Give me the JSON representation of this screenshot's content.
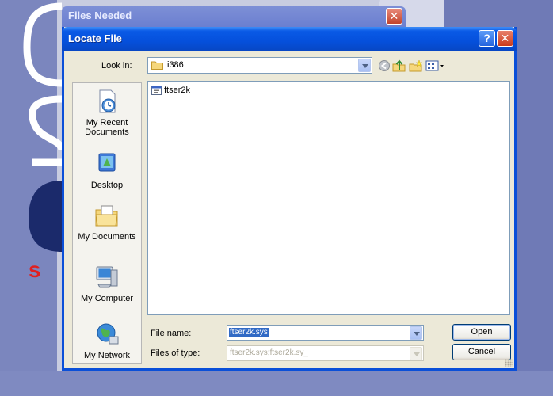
{
  "background_window": {
    "title": "Files Needed",
    "close_glyph": "✕"
  },
  "dialog": {
    "title": "Locate File",
    "help_glyph": "?",
    "close_glyph": "✕",
    "look_in": {
      "label": "Look in:",
      "value": "i386"
    },
    "toolbar_icons": [
      "back-icon",
      "up-folder-icon",
      "new-folder-icon",
      "view-menu-icon"
    ],
    "places": [
      {
        "label": "My Recent Documents",
        "icon": "recent-documents-icon"
      },
      {
        "label": "Desktop",
        "icon": "desktop-icon"
      },
      {
        "label": "My Documents",
        "icon": "my-documents-icon"
      },
      {
        "label": "My Computer",
        "icon": "my-computer-icon"
      },
      {
        "label": "My Network",
        "icon": "my-network-icon"
      }
    ],
    "files": [
      {
        "name": "ftser2k",
        "icon": "system-file-icon"
      }
    ],
    "file_name": {
      "label": "File name:",
      "value": "ftser2k.sys"
    },
    "file_type": {
      "label": "Files of type:",
      "value": "ftser2k.sys;ftser2k.sy_"
    },
    "buttons": {
      "open": "Open",
      "cancel": "Cancel"
    }
  },
  "colors": {
    "titlebar": "#0550dc",
    "dialog_face": "#ece9d8",
    "selection": "#316ac5"
  }
}
